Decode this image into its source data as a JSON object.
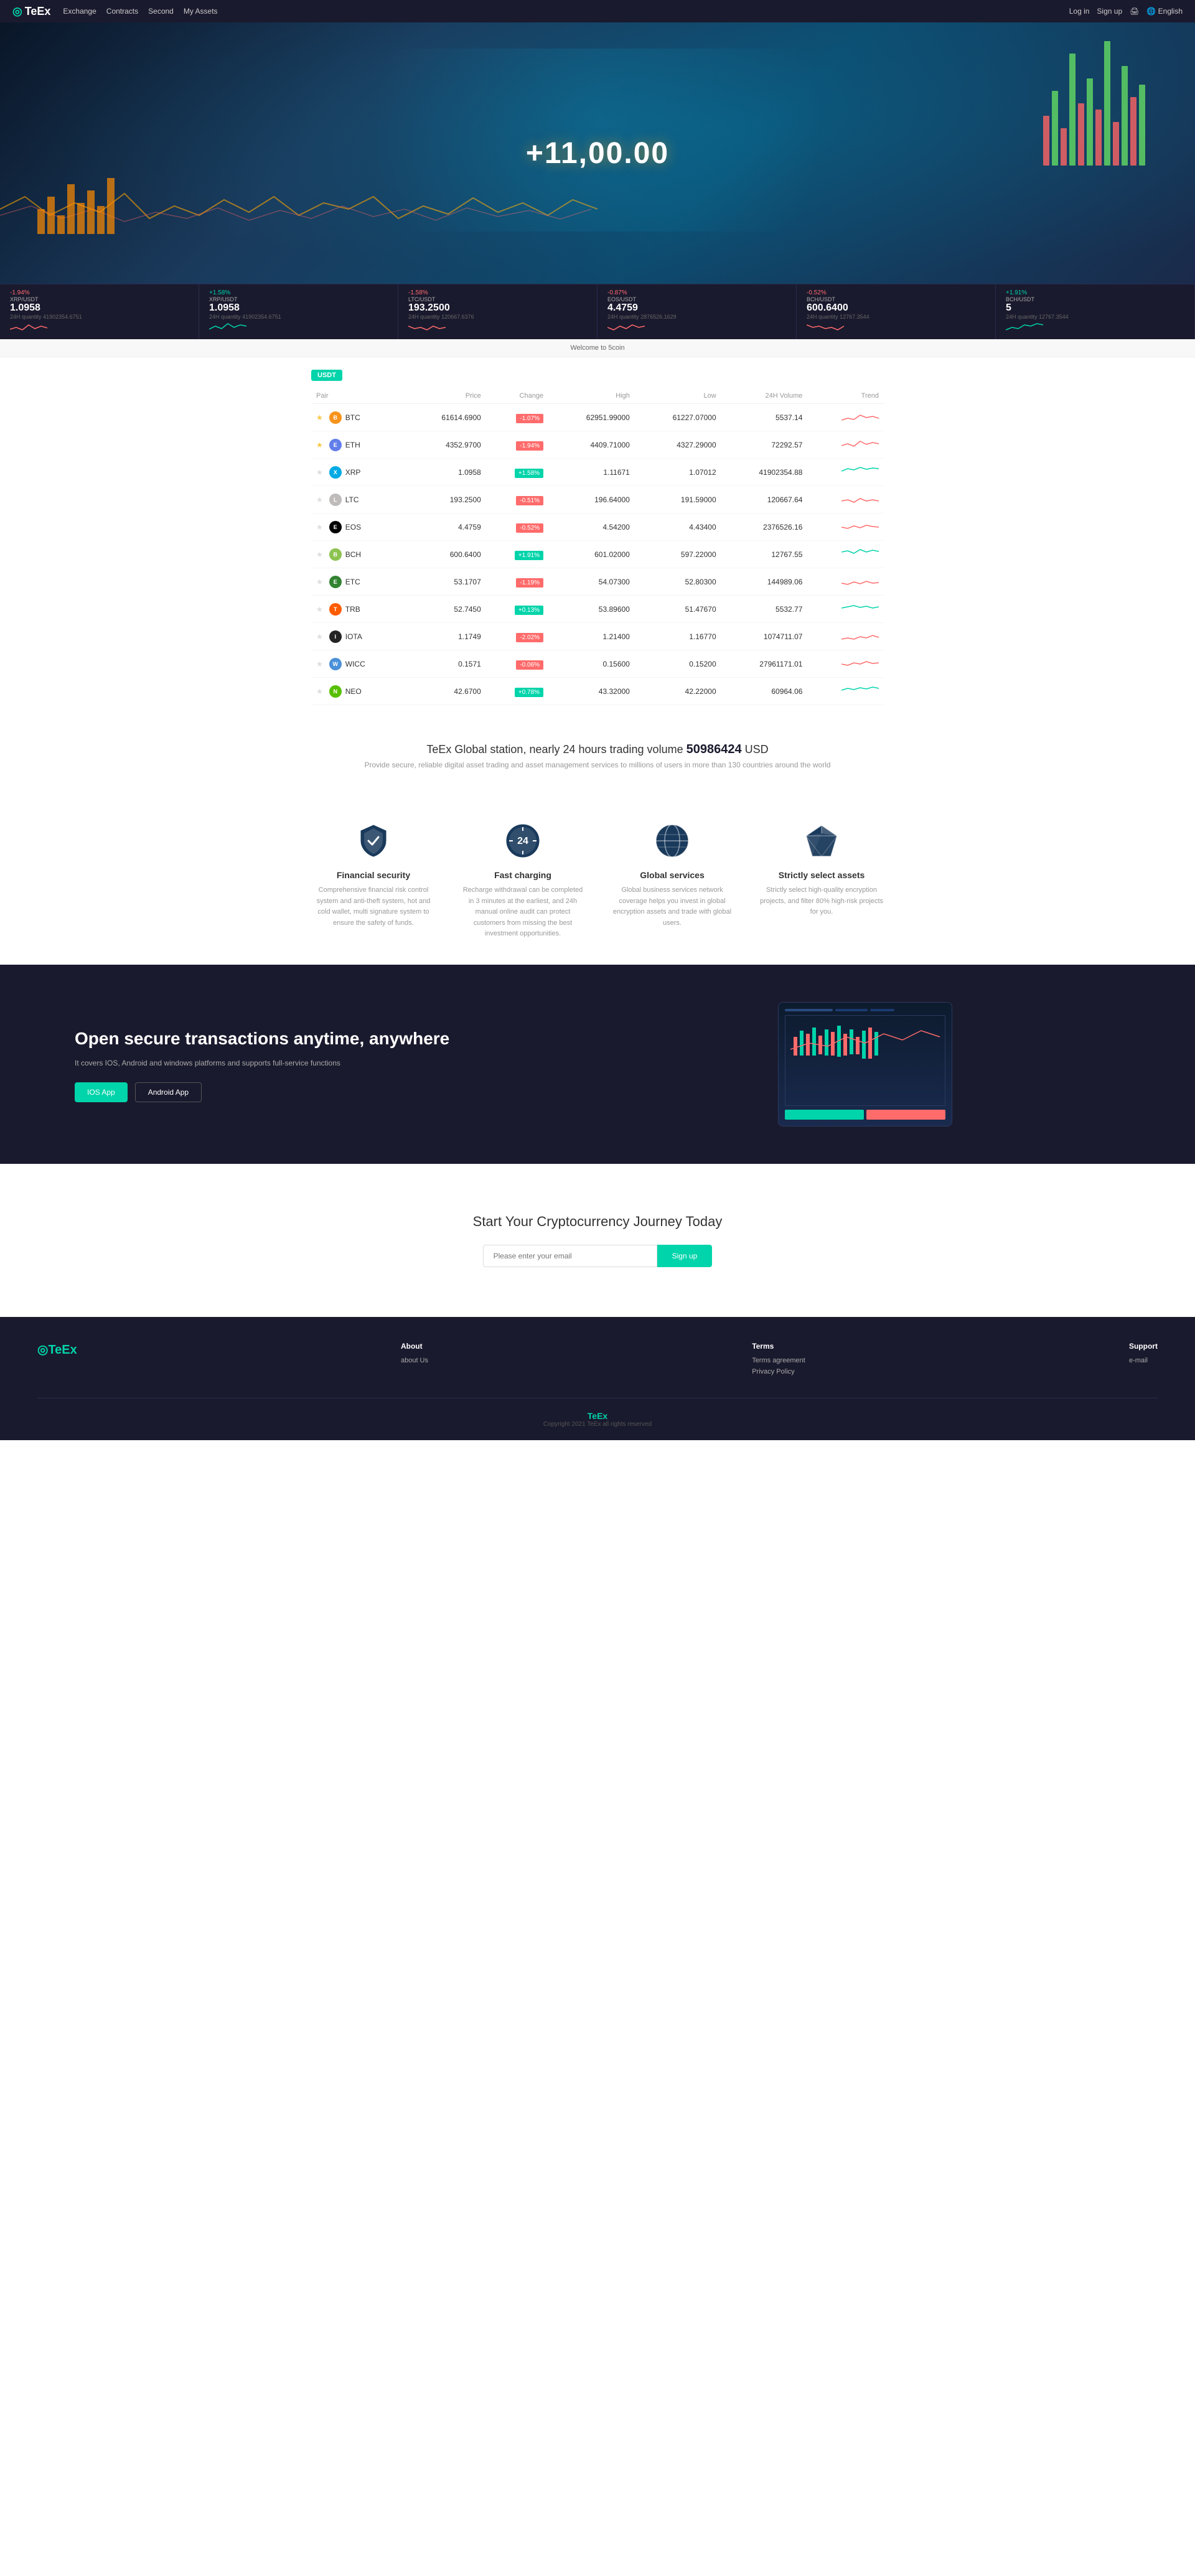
{
  "navbar": {
    "logo": "TeEx",
    "nav_items": [
      {
        "label": "Exchange",
        "href": "#"
      },
      {
        "label": "Contracts",
        "href": "#"
      },
      {
        "label": "Second",
        "href": "#"
      },
      {
        "label": "My Assets",
        "href": "#"
      }
    ],
    "right_items": [
      {
        "label": "Log in",
        "href": "#"
      },
      {
        "label": "Sign up",
        "href": "#"
      },
      {
        "label": "🖨",
        "href": "#"
      },
      {
        "label": "🌐 English",
        "href": "#"
      }
    ]
  },
  "hero": {
    "amount": "+11,00.00"
  },
  "welcome": {
    "text": "Welcome to 5coin"
  },
  "ticker": {
    "items": [
      {
        "pair": "XRP/USDT",
        "change": "-1.94%",
        "price": "1.0958",
        "vol_label": "24H quantity",
        "vol": "41902354.6751",
        "change_type": "neg"
      },
      {
        "pair": "XRP/USDT",
        "change": "+1.58%",
        "price": "1.0958",
        "vol_label": "24H quantity",
        "vol": "41902354.6751",
        "change_type": "pos"
      },
      {
        "pair": "LTC/USDT",
        "change": "-1.58%",
        "price": "193.2500",
        "vol_label": "24H quantity",
        "vol": "120667.6376",
        "change_type": "neg"
      },
      {
        "pair": "EOS/USDT",
        "change": "-0.87%",
        "price": "4.4759",
        "vol_label": "24H quantity",
        "vol": "2876526.1629",
        "change_type": "neg"
      },
      {
        "pair": "BCH/USDT",
        "change": "-0.52%",
        "price": "600.6400",
        "vol_label": "24H quantity",
        "vol": "12767.3544",
        "change_type": "neg"
      },
      {
        "pair": "BCH/USDT",
        "change": "+1.91%",
        "price": "5",
        "vol_label": "24H quantity",
        "vol": "12767.3544",
        "change_type": "pos"
      }
    ]
  },
  "table": {
    "badge": "USDT",
    "headers": [
      "Pair",
      "Price",
      "Change",
      "High",
      "Low",
      "24H Volume",
      "Trend"
    ],
    "rows": [
      {
        "coin": "BTC",
        "icon_class": "btc",
        "price": "61614.6900",
        "change": "-1.07%",
        "change_type": "neg",
        "high": "62951.99000",
        "low": "61227.07000",
        "vol": "5537.14",
        "star": true
      },
      {
        "coin": "ETH",
        "icon_class": "eth",
        "price": "4352.9700",
        "change": "-1.94%",
        "change_type": "neg",
        "high": "4409.71000",
        "low": "4327.29000",
        "vol": "72292.57",
        "star": true
      },
      {
        "coin": "XRP",
        "icon_class": "xrp",
        "price": "1.0958",
        "change": "+1.58%",
        "change_type": "pos",
        "high": "1.11671",
        "low": "1.07012",
        "vol": "41902354.88",
        "star": false
      },
      {
        "coin": "LTC",
        "icon_class": "ltc",
        "price": "193.2500",
        "change": "-0.51%",
        "change_type": "neg",
        "high": "196.64000",
        "low": "191.59000",
        "vol": "120667.64",
        "star": false
      },
      {
        "coin": "EOS",
        "icon_class": "eos",
        "price": "4.4759",
        "change": "-0.52%",
        "change_type": "neg",
        "high": "4.54200",
        "low": "4.43400",
        "vol": "2376526.16",
        "star": false
      },
      {
        "coin": "BCH",
        "icon_class": "bch",
        "price": "600.6400",
        "change": "+1.91%",
        "change_type": "pos",
        "high": "601.02000",
        "low": "597.22000",
        "vol": "12767.55",
        "star": false
      },
      {
        "coin": "ETC",
        "icon_class": "etc",
        "price": "53.1707",
        "change": "-1.19%",
        "change_type": "neg",
        "high": "54.07300",
        "low": "52.80300",
        "vol": "144989.06",
        "star": false
      },
      {
        "coin": "TRB",
        "icon_class": "trb",
        "price": "52.7450",
        "change": "+0.13%",
        "change_type": "pos",
        "high": "53.89600",
        "low": "51.47670",
        "vol": "5532.77",
        "star": false
      },
      {
        "coin": "IOTA",
        "icon_class": "iota",
        "price": "1.1749",
        "change": "-2.02%",
        "change_type": "neg",
        "high": "1.21400",
        "low": "1.16770",
        "vol": "1074711.07",
        "star": false
      },
      {
        "coin": "WICC",
        "icon_class": "wicc",
        "price": "0.1571",
        "change": "-0.06%",
        "change_type": "neg",
        "high": "0.15600",
        "low": "0.15200",
        "vol": "27961171.01",
        "star": false
      },
      {
        "coin": "NEO",
        "icon_class": "neo",
        "price": "42.6700",
        "change": "+0.78%",
        "change_type": "pos",
        "high": "43.32000",
        "low": "42.22000",
        "vol": "60964.06",
        "star": false
      }
    ]
  },
  "stats": {
    "title_prefix": "TeEx Global station, nearly 24 hours trading volume",
    "amount": "50986424",
    "currency": "USD",
    "subtitle": "Provide secure, reliable digital asset trading and asset management services to millions of users in more than 130 countries around the world"
  },
  "features": [
    {
      "id": "financial-security",
      "title": "Financial security",
      "desc": "Comprehensive financial risk control system and anti-theft system, hot and cold wallet, multi signature system to ensure the safety of funds.",
      "icon": "shield"
    },
    {
      "id": "fast-charging",
      "title": "Fast charging",
      "desc": "Recharge withdrawal can be completed in 3 minutes at the earliest, and 24h manual online audit can protect customers from missing the best investment opportunities.",
      "icon": "clock24"
    },
    {
      "id": "global-services",
      "title": "Global services",
      "desc": "Global business services network coverage helps you invest in global encryption assets and trade with global users.",
      "icon": "globe"
    },
    {
      "id": "strictly-assets",
      "title": "Strictly select assets",
      "desc": "Strictly select high-quality encryption projects, and filter 80% high-risk projects for you.",
      "icon": "diamond"
    }
  ],
  "dark_section": {
    "title": "Open secure transactions anytime, anywhere",
    "subtitle": "It covers IOS, Android and windows platforms and supports full-service functions",
    "btn_ios": "IOS App",
    "btn_android": "Android App"
  },
  "signup_section": {
    "title": "Start Your Cryptocurrency Journey Today",
    "input_placeholder": "Please enter your email",
    "btn_label": "Sign up"
  },
  "footer": {
    "logo": "◎TeEx",
    "columns": [
      {
        "title": "About",
        "links": [
          {
            "label": "about Us",
            "href": "#"
          }
        ]
      },
      {
        "title": "Terms",
        "links": [
          {
            "label": "Terms agreement",
            "href": "#"
          },
          {
            "label": "Privacy Policy",
            "href": "#"
          }
        ]
      },
      {
        "title": "Support",
        "links": [
          {
            "label": "e-mail",
            "href": "#"
          }
        ]
      }
    ],
    "copyright": "TeEx",
    "copyright_sub": "Copyright 2021 TeEx all rights reserved"
  }
}
